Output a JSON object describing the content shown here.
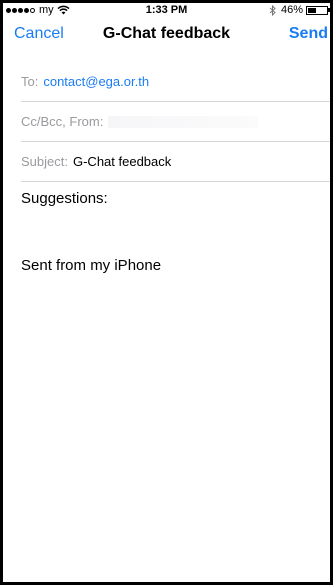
{
  "status_bar": {
    "carrier": "my",
    "time": "1:33 PM",
    "battery_percent_label": "46%",
    "battery_level": 0.46
  },
  "nav": {
    "cancel_label": "Cancel",
    "title": "G-Chat feedback",
    "send_label": "Send"
  },
  "fields": {
    "to_label": "To:",
    "to_value": "contact@ega.or.th",
    "cc_label": "Cc/Bcc, From:",
    "subject_label": "Subject:",
    "subject_value": "G-Chat feedback"
  },
  "body": {
    "line1": "Suggestions:",
    "signature": "Sent from my iPhone"
  },
  "colors": {
    "accent": "#1a7cf5",
    "label_gray": "#9a9a9f",
    "separator": "#d8d8dc"
  }
}
